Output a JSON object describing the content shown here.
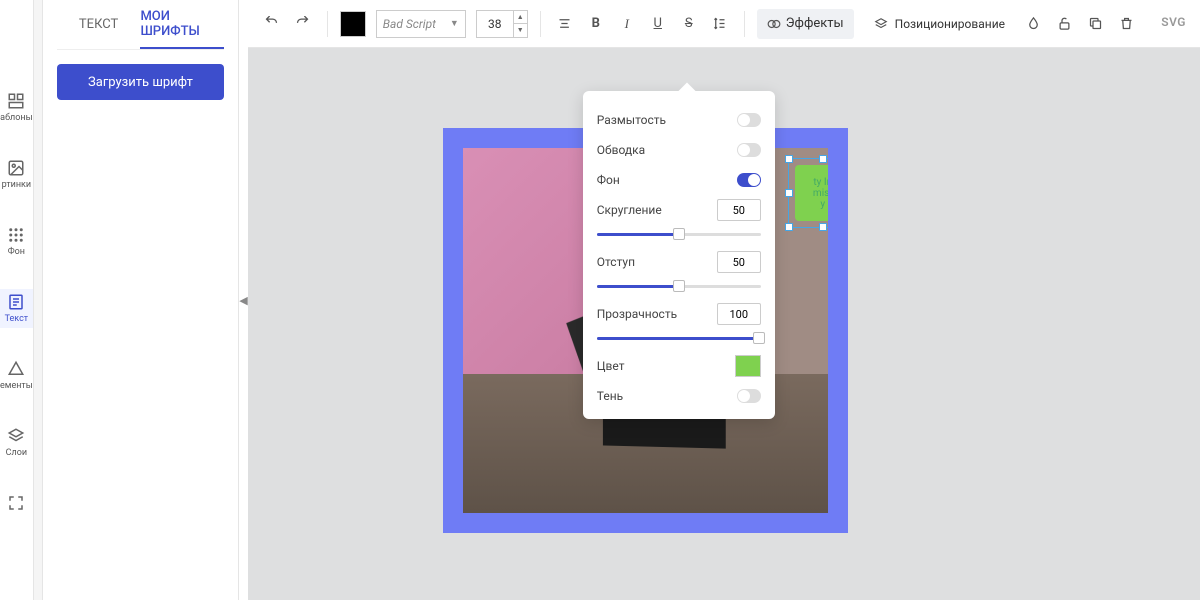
{
  "leftbar": {
    "items": [
      {
        "key": "templates",
        "label": "аблоны"
      },
      {
        "key": "pictures",
        "label": "ртинки"
      },
      {
        "key": "background",
        "label": "Фон"
      },
      {
        "key": "text",
        "label": "Текст"
      },
      {
        "key": "elements",
        "label": "ементы"
      },
      {
        "key": "layers",
        "label": "Слои"
      },
      {
        "key": "fullscreen",
        "label": ""
      }
    ]
  },
  "sidepanel": {
    "tabs": {
      "text": "ТЕКСТ",
      "myfonts": "МОИ ШРИФТЫ"
    },
    "upload_btn": "Загрузить шрифт"
  },
  "toolbar": {
    "font_name": "Bad Script",
    "font_size": "38",
    "effects_label": "Эффекты",
    "positioning_label": "Позиционирование",
    "svg_badge": "SVG"
  },
  "effects": {
    "blur": "Размытость",
    "stroke": "Обводка",
    "bg": "Фон",
    "radius": "Скругление",
    "radius_val": "50",
    "padding": "Отступ",
    "padding_val": "50",
    "opacity": "Прозрачность",
    "opacity_val": "100",
    "color": "Цвет",
    "shadow": "Тень",
    "bg_on": true,
    "color_hex": "#7fd14f"
  },
  "canvas": {
    "sel_text_l1": "ty In",
    "sel_text_l2": "mist",
    "sel_text_l3": "y"
  }
}
